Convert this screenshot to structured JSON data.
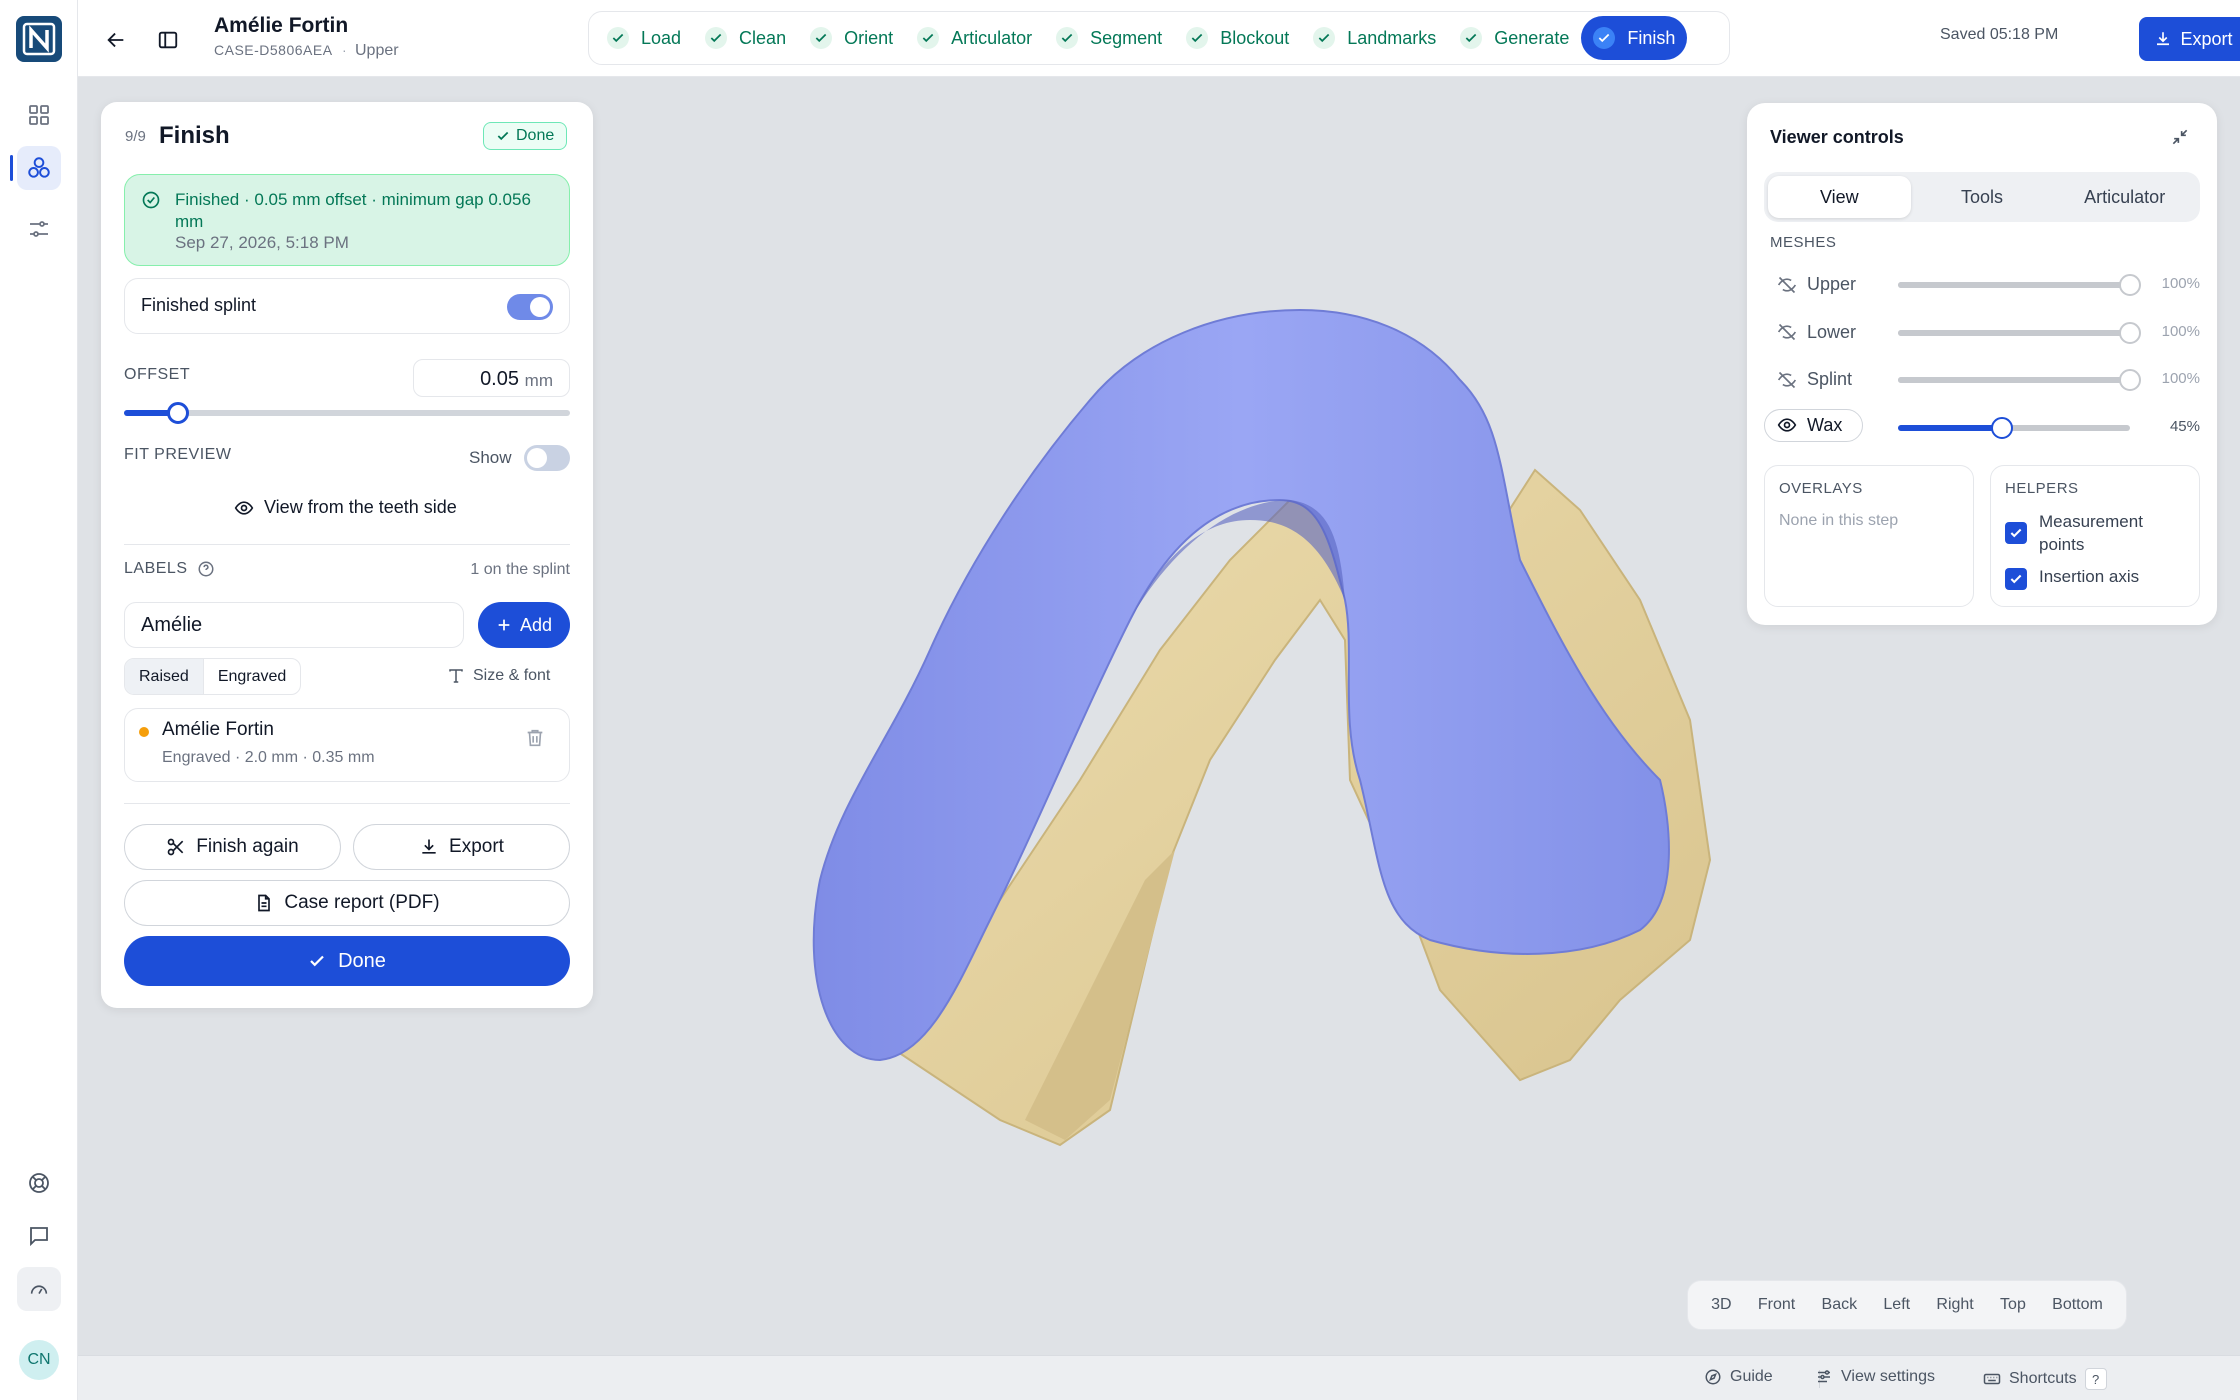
{
  "header": {
    "patient_name": "Amélie Fortin",
    "case_id": "CASE-D5806AEA",
    "separator": "·",
    "jaw": "Upper",
    "saved": "Saved 05:18 PM",
    "export_label": "Export"
  },
  "steps": [
    {
      "label": "Load",
      "done": true
    },
    {
      "label": "Clean",
      "done": true
    },
    {
      "label": "Orient",
      "done": true
    },
    {
      "label": "Articulator",
      "done": true
    },
    {
      "label": "Segment",
      "done": true
    },
    {
      "label": "Blockout",
      "done": true
    },
    {
      "label": "Landmarks",
      "done": true
    },
    {
      "label": "Generate",
      "done": true
    },
    {
      "label": "Finish",
      "done": true,
      "active": true
    }
  ],
  "rail": {
    "avatar_initials": "CN"
  },
  "panel": {
    "step_num": "9/9",
    "title": "Finish",
    "badge": "Done",
    "status_text": "Finished · 0.05 mm offset · minimum gap 0.056 mm",
    "status_time": "Sep 27, 2026, 5:18 PM",
    "finished_splint_label": "Finished splint",
    "finished_splint_on": true,
    "offset_label": "OFFSET",
    "offset_value": "0.05",
    "offset_unit": "mm",
    "offset_fraction": 0.12,
    "fit_preview_label": "FIT PREVIEW",
    "fit_show_label": "Show",
    "fit_show_on": false,
    "view_teeth_label": "View from the teeth side",
    "labels_label": "LABELS",
    "labels_count": "1 on the splint",
    "name_input_value": "Amélie",
    "add_label": "Add",
    "raised_label": "Raised",
    "engraved_label": "Engraved",
    "size_font_label": "Size & font",
    "label_item": {
      "name": "Amélie Fortin",
      "detail": "Engraved · 2.0 mm · 0.35 mm"
    },
    "finish_again_label": "Finish again",
    "export_label": "Export",
    "case_report_label": "Case report (PDF)",
    "done_label": "Done"
  },
  "viewer": {
    "title": "Viewer controls",
    "tabs": [
      "View",
      "Tools",
      "Articulator"
    ],
    "meshes_label": "MESHES",
    "meshes": [
      {
        "name": "Upper",
        "percent": "100%",
        "value": 1.0,
        "visible": false
      },
      {
        "name": "Lower",
        "percent": "100%",
        "value": 1.0,
        "visible": false
      },
      {
        "name": "Splint",
        "percent": "100%",
        "value": 1.0,
        "visible": false
      },
      {
        "name": "Wax",
        "percent": "45%",
        "value": 0.45,
        "visible": true
      }
    ],
    "overlays_label": "OVERLAYS",
    "overlays_text": "None in this step",
    "helpers_label": "HELPERS",
    "helpers": [
      {
        "label": "Measurement points",
        "checked": true
      },
      {
        "label": "Insertion axis",
        "checked": true
      }
    ]
  },
  "viewbar": [
    "3D",
    "Front",
    "Back",
    "Left",
    "Right",
    "Top",
    "Bottom"
  ],
  "statusbar": {
    "guide": "Guide",
    "view_settings": "View settings",
    "shortcuts": "Shortcuts",
    "shortcut_key": "?"
  },
  "colors": {
    "accent": "#1d4ed8",
    "success": "#047857",
    "splint": "#8f9cf0",
    "model": "#e5d3a3"
  }
}
